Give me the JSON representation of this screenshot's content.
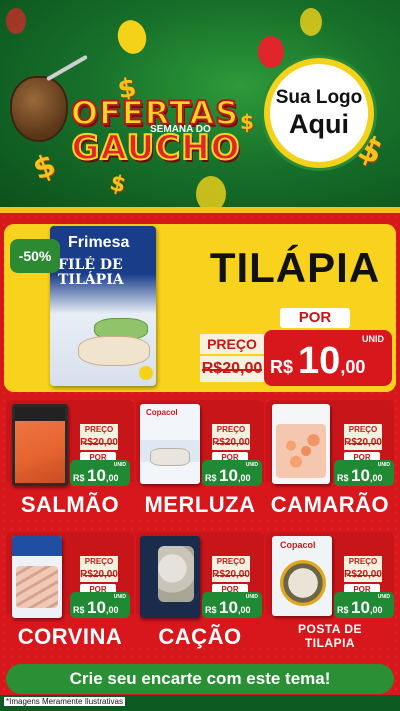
{
  "header": {
    "title_line1": "OFERTAS",
    "title_middle": "SEMANA DO",
    "title_line2": "GAUCHO",
    "logo_line1": "Sua Logo",
    "logo_line2": "Aqui"
  },
  "colors": {
    "background_green": "#17702a",
    "main_red": "#d8171c",
    "featured_yellow": "#f8d21c",
    "price_green": "#1f8a33"
  },
  "featured": {
    "discount": "-50%",
    "package_brand": "Frimesa",
    "package_title": "FILÉ DE TILÁPIA",
    "name": "TILÁPIA",
    "preco_label": "PREÇO",
    "old_price": "R$20,00",
    "por_label": "POR",
    "unit": "UNID",
    "currency": "R$",
    "new_price_int": "10",
    "new_price_dec": ",00"
  },
  "products": [
    {
      "name": "SALMÃO",
      "image_icon": "salmon-package-icon",
      "preco_label": "PREÇO",
      "old_price": "R$20,00",
      "por_label": "POR",
      "unit": "UNID",
      "currency": "R$",
      "price_int": "10",
      "price_dec": ",00"
    },
    {
      "name": "MERLUZA",
      "package_brand": "Copacol",
      "image_icon": "merluza-package-icon",
      "preco_label": "PREÇO",
      "old_price": "R$20,00",
      "por_label": "POR",
      "unit": "UNID",
      "currency": "R$",
      "price_int": "10",
      "price_dec": ",00"
    },
    {
      "name": "CAMARÃO",
      "image_icon": "camarao-package-icon",
      "preco_label": "PREÇO",
      "old_price": "R$20,00",
      "por_label": "POR",
      "unit": "UNID",
      "currency": "R$",
      "price_int": "10",
      "price_dec": ",00"
    },
    {
      "name": "CORVINA",
      "image_icon": "corvina-package-icon",
      "preco_label": "PREÇO",
      "old_price": "R$20,00",
      "por_label": "POR",
      "unit": "UNID",
      "currency": "R$",
      "price_int": "10",
      "price_dec": ",00"
    },
    {
      "name": "CAÇÃO",
      "image_icon": "cacao-package-icon",
      "preco_label": "PREÇO",
      "old_price": "R$20,00",
      "por_label": "POR",
      "unit": "UNID",
      "currency": "R$",
      "price_int": "10",
      "price_dec": ",00"
    },
    {
      "name": "POSTA DE TILAPIA",
      "package_brand": "Copacol",
      "image_icon": "posta-tilapia-package-icon",
      "preco_label": "PREÇO",
      "old_price": "R$20,00",
      "por_label": "POR",
      "unit": "UNID",
      "currency": "R$",
      "price_int": "10",
      "price_dec": ",00"
    }
  ],
  "cta": "Crie seu encarte com este tema!",
  "disclaimer": "*Imagens Meramente Ilustrativas"
}
